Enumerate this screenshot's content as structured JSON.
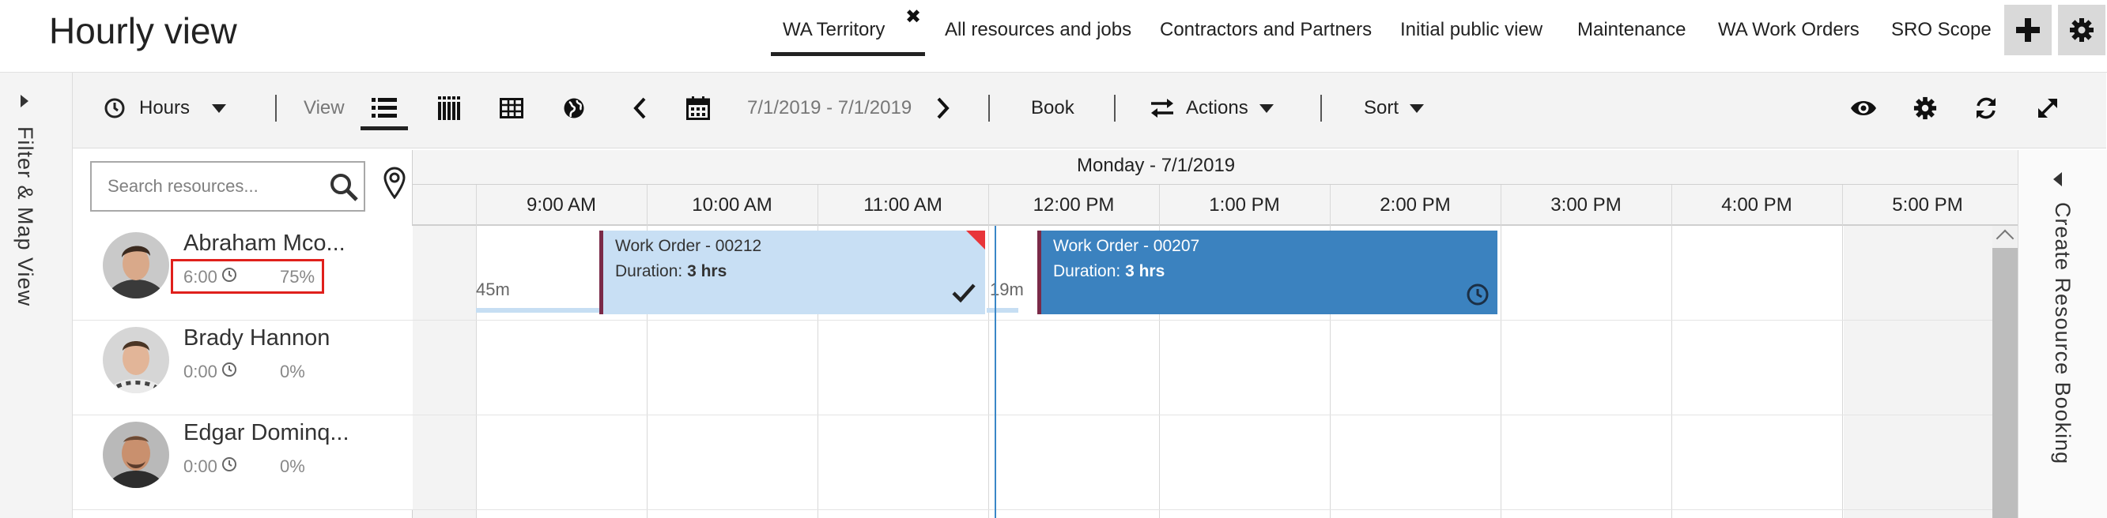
{
  "header": {
    "title": "Hourly view",
    "tabs": [
      {
        "label": "WA Territory"
      },
      {
        "label": "All resources and jobs"
      },
      {
        "label": "Contractors and Partners"
      },
      {
        "label": "Initial public view"
      },
      {
        "label": "Maintenance"
      },
      {
        "label": "WA Work Orders"
      },
      {
        "label": "SRO Scope"
      }
    ]
  },
  "filter_rail": {
    "label": "Filter & Map View"
  },
  "create_rail": {
    "label": "Create Resource Booking"
  },
  "toolbar": {
    "hours_label": "Hours",
    "view_label": "View",
    "date_range": "7/1/2019 - 7/1/2019",
    "book_label": "Book",
    "actions_label": "Actions",
    "sort_label": "Sort"
  },
  "search": {
    "placeholder": "Search resources..."
  },
  "resources": [
    {
      "name": "Abraham Mco...",
      "hours": "6:00",
      "utilization": "75%"
    },
    {
      "name": "Brady Hannon",
      "hours": "0:00",
      "utilization": "0%"
    },
    {
      "name": "Edgar Dominq...",
      "hours": "0:00",
      "utilization": "0%"
    }
  ],
  "schedule": {
    "day_label": "Monday - 7/1/2019",
    "hours": [
      "9:00 AM",
      "10:00 AM",
      "11:00 AM",
      "12:00 PM",
      "1:00 PM",
      "2:00 PM",
      "3:00 PM",
      "4:00 PM",
      "5:00 PM"
    ]
  },
  "bookings": [
    {
      "title": "Work Order - 00212",
      "duration_label": "Duration:",
      "duration": "3 hrs",
      "travel": "45m",
      "status_icon": "checkmark-icon"
    },
    {
      "title": "Work Order - 00207",
      "duration_label": "Duration:",
      "duration": "3 hrs",
      "travel": "19m",
      "status_icon": "clock-icon"
    }
  ],
  "colors": {
    "booking_light": "#c8dff4",
    "booking_dark": "#3b82bf",
    "booking_edge": "#7a2a48",
    "highlight": "#e0201c",
    "now_line": "#3a87c7"
  }
}
